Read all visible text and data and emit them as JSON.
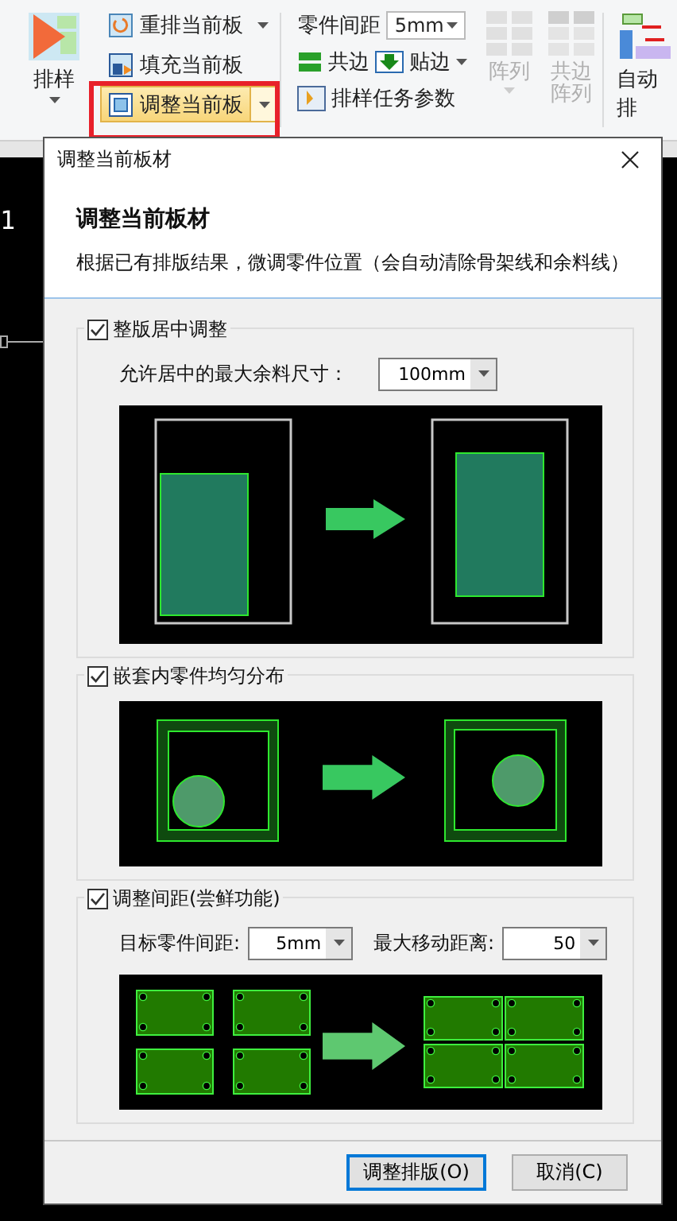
{
  "canvas": {
    "label": "1"
  },
  "ribbon": {
    "main_button": {
      "label": "排样"
    },
    "commands": [
      {
        "label": "重排当前板",
        "selected": false,
        "dropdown": true
      },
      {
        "label": "填充当前板",
        "selected": false,
        "dropdown": false
      },
      {
        "label": "调整当前板",
        "selected": true,
        "dropdown": true
      }
    ],
    "spacing": {
      "label": "零件间距",
      "value": "5mm"
    },
    "edge_buttons": [
      {
        "label": "共边"
      },
      {
        "label": "贴边"
      }
    ],
    "task_params": {
      "label": "排样任务参数"
    },
    "array_buttons": [
      {
        "label": "阵列",
        "disabled": true
      },
      {
        "label": "共边阵列",
        "disabled": true
      }
    ],
    "auto_button": {
      "label": "自动排"
    }
  },
  "dialog": {
    "title": "调整当前板材",
    "heading": "调整当前板材",
    "description": "根据已有排版结果，微调零件位置（会自动清除骨架线和余料线）",
    "sections": [
      {
        "label": "整版居中调整",
        "checked": true,
        "kind": "center",
        "fields": [
          {
            "label": "允许居中的最大余料尺寸：",
            "value": "100mm"
          }
        ]
      },
      {
        "label": "嵌套内零件均匀分布",
        "checked": true,
        "kind": "nest"
      },
      {
        "label": "调整间距(尝鲜功能)",
        "checked": true,
        "kind": "spacing",
        "fields": [
          {
            "label": "目标零件间距:",
            "value": "5mm"
          },
          {
            "label": "最大移动距离:",
            "value": "50"
          }
        ]
      }
    ],
    "buttons": [
      {
        "label": "调整排版(O)",
        "default": true
      },
      {
        "label": "取消(C)",
        "default": false
      }
    ]
  }
}
